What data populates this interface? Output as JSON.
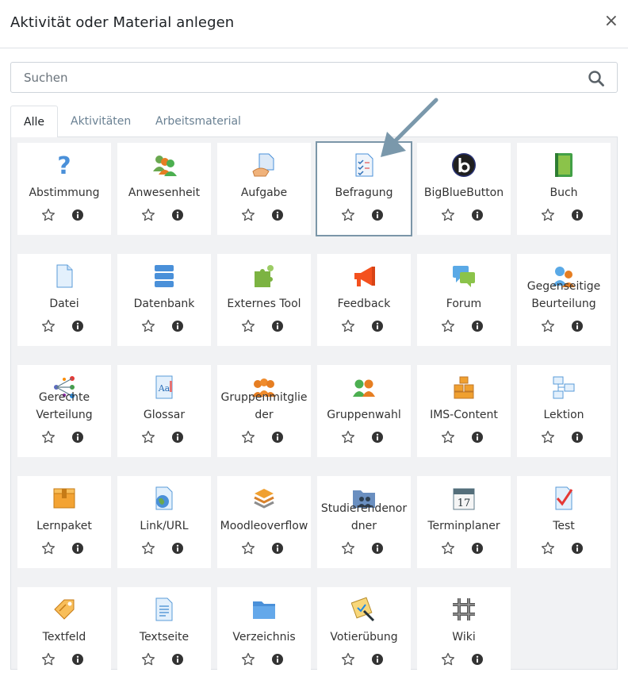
{
  "dialog": {
    "title": "Aktivität oder Material anlegen",
    "close_glyph": "×"
  },
  "search": {
    "placeholder": "Suchen",
    "value": ""
  },
  "tabs": [
    {
      "label": "Alle",
      "active": true
    },
    {
      "label": "Aktivitäten",
      "active": false
    },
    {
      "label": "Arbeitsmaterial",
      "active": false
    }
  ],
  "activities": [
    {
      "lines": [
        "Abstimmung"
      ],
      "icon": "question-icon"
    },
    {
      "lines": [
        "Anwesenheit"
      ],
      "icon": "attendance-icon"
    },
    {
      "lines": [
        "Aufgabe"
      ],
      "icon": "assignment-icon"
    },
    {
      "lines": [
        "Befragung"
      ],
      "icon": "survey-icon",
      "highlighted": true
    },
    {
      "lines": [
        "BigBlueButton"
      ],
      "icon": "bigbluebutton-icon"
    },
    {
      "lines": [
        "Buch"
      ],
      "icon": "book-icon"
    },
    {
      "lines": [
        "Datei"
      ],
      "icon": "file-icon"
    },
    {
      "lines": [
        "Datenbank"
      ],
      "icon": "database-icon"
    },
    {
      "lines": [
        "Externes Tool"
      ],
      "icon": "puzzle-icon"
    },
    {
      "lines": [
        "Feedback"
      ],
      "icon": "megaphone-icon"
    },
    {
      "lines": [
        "Forum"
      ],
      "icon": "forum-icon"
    },
    {
      "lines": [
        "Gegenseitige",
        "Beurteilung"
      ],
      "icon": "workshop-icon"
    },
    {
      "lines": [
        "Gerechte",
        "Verteilung"
      ],
      "icon": "distribution-icon"
    },
    {
      "lines": [
        "Glossar"
      ],
      "icon": "glossary-icon"
    },
    {
      "lines": [
        "Gruppenmitglie",
        "der"
      ],
      "icon": "group-members-icon"
    },
    {
      "lines": [
        "Gruppenwahl"
      ],
      "icon": "group-choice-icon"
    },
    {
      "lines": [
        "IMS-Content"
      ],
      "icon": "ims-content-icon"
    },
    {
      "lines": [
        "Lektion"
      ],
      "icon": "lesson-icon"
    },
    {
      "lines": [
        "Lernpaket"
      ],
      "icon": "package-icon"
    },
    {
      "lines": [
        "Link/URL"
      ],
      "icon": "globe-icon"
    },
    {
      "lines": [
        "Moodleoverflow"
      ],
      "icon": "stack-icon"
    },
    {
      "lines": [
        "Studierendenor",
        "dner"
      ],
      "icon": "student-folder-icon"
    },
    {
      "lines": [
        "Terminplaner"
      ],
      "icon": "calendar-icon"
    },
    {
      "lines": [
        "Test"
      ],
      "icon": "quiz-icon"
    },
    {
      "lines": [
        "Textfeld"
      ],
      "icon": "label-tag-icon"
    },
    {
      "lines": [
        "Textseite"
      ],
      "icon": "page-icon"
    },
    {
      "lines": [
        "Verzeichnis"
      ],
      "icon": "folder-icon"
    },
    {
      "lines": [
        "Votierübung"
      ],
      "icon": "vote-exercise-icon"
    },
    {
      "lines": [
        "Wiki"
      ],
      "icon": "wiki-icon"
    }
  ],
  "colors": {
    "highlight_border": "#7b96a8",
    "arrow": "#7a98ab",
    "tab_inactive": "#6a8193"
  }
}
